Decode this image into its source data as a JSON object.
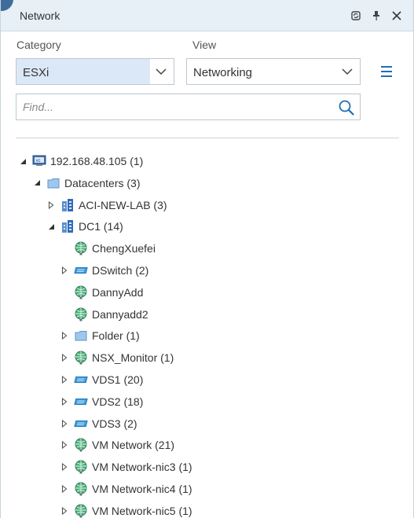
{
  "panel": {
    "title": "Network",
    "accent": "#1f6fb5",
    "controls": [
      "refresh-icon",
      "pin-icon",
      "close-icon"
    ]
  },
  "filters": {
    "category_label": "Category",
    "category_value": "ESXi",
    "view_label": "View",
    "view_value": "Networking",
    "find_placeholder": "Find..."
  },
  "tree": [
    {
      "label": "192.168.48.105 (1)",
      "icon": "vcenter-icon",
      "expander": "expanded"
    },
    {
      "label": "Datacenters (3)",
      "icon": "folder-icon",
      "expander": "expanded"
    },
    {
      "label": "ACI-NEW-LAB (3)",
      "icon": "datacenter-icon",
      "expander": "collapsed"
    },
    {
      "label": "DC1 (14)",
      "icon": "datacenter-icon",
      "expander": "expanded"
    },
    {
      "label": "ChengXuefei",
      "icon": "network-globe-icon",
      "expander": "none"
    },
    {
      "label": "DSwitch (2)",
      "icon": "dvswitch-icon",
      "expander": "collapsed"
    },
    {
      "label": "DannyAdd",
      "icon": "network-globe-icon",
      "expander": "none"
    },
    {
      "label": "Dannyadd2",
      "icon": "network-globe-icon",
      "expander": "none"
    },
    {
      "label": "Folder (1)",
      "icon": "folder-icon",
      "expander": "collapsed"
    },
    {
      "label": "NSX_Monitor (1)",
      "icon": "network-globe-icon",
      "expander": "collapsed"
    },
    {
      "label": "VDS1 (20)",
      "icon": "dvswitch-icon",
      "expander": "collapsed"
    },
    {
      "label": "VDS2 (18)",
      "icon": "dvswitch-icon",
      "expander": "collapsed"
    },
    {
      "label": "VDS3 (2)",
      "icon": "dvswitch-icon",
      "expander": "collapsed"
    },
    {
      "label": "VM Network (21)",
      "icon": "network-globe-icon",
      "expander": "collapsed"
    },
    {
      "label": "VM Network-nic3 (1)",
      "icon": "network-globe-icon",
      "expander": "collapsed"
    },
    {
      "label": "VM Network-nic4 (1)",
      "icon": "network-globe-icon",
      "expander": "collapsed"
    },
    {
      "label": "VM Network-nic5 (1)",
      "icon": "network-globe-icon",
      "expander": "collapsed"
    }
  ]
}
